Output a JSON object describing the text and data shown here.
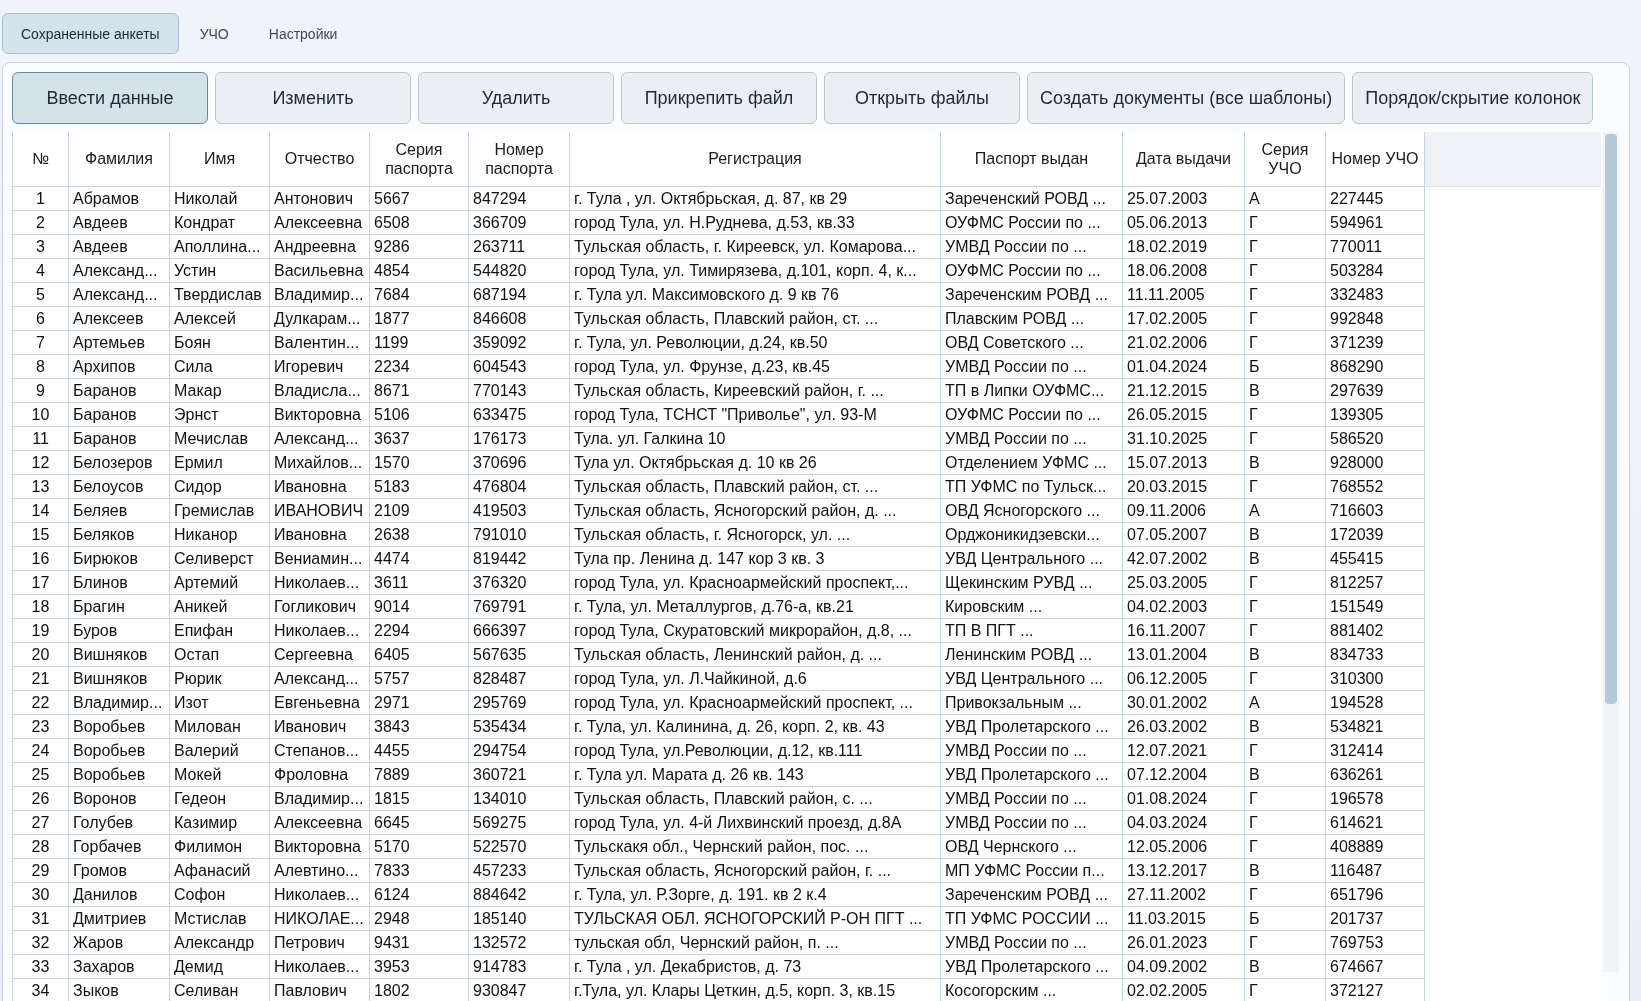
{
  "tabs": [
    {
      "label": "Сохраненные анкеты",
      "selected": true
    },
    {
      "label": "УЧО",
      "selected": false
    },
    {
      "label": "Настройки",
      "selected": false
    }
  ],
  "buttons": [
    {
      "label": "Ввести данные",
      "default": true
    },
    {
      "label": "Изменить",
      "default": false
    },
    {
      "label": "Удалить",
      "default": false
    },
    {
      "label": "Прикрепить файл",
      "default": false
    },
    {
      "label": "Открыть файлы",
      "default": false
    },
    {
      "label": "Создать документы (все шаблоны)",
      "default": false
    },
    {
      "label": "Порядок/скрытие колонок",
      "default": false
    }
  ],
  "table": {
    "columns": [
      "№",
      "Фамилия",
      "Имя",
      "Отчество",
      "Серия паспорта",
      "Номер паспорта",
      "Регистрация",
      "Паспорт выдан",
      "Дата выдачи",
      "Серия УЧО",
      "Номер УЧО"
    ],
    "rows": [
      [
        "1",
        "Абрамов",
        "Николай",
        "Антонович",
        "5667",
        "847294",
        "г. Тула , ул. Октябрьская, д. 87, кв 29",
        "Зареченский РОВД ...",
        "25.07.2003",
        "А",
        "227445"
      ],
      [
        "2",
        "Авдеев",
        "Кондрат",
        "Алексеевна",
        "6508",
        "366709",
        "город Тула, ул. Н.Руднева, д.53, кв.33",
        "ОУФМС России по ...",
        "05.06.2013",
        "Г",
        "594961"
      ],
      [
        "3",
        "Авдеев",
        "Аполлина...",
        "Андреевна",
        "9286",
        "263711",
        "Тульская область, г. Киреевск, ул. Комарова...",
        "УМВД России по ...",
        "18.02.2019",
        "Г",
        "770011"
      ],
      [
        "4",
        "Александ...",
        "Устин",
        "Васильевна",
        "4854",
        "544820",
        "город Тула, ул. Тимирязева, д.101, корп. 4, к...",
        "ОУФМС России по ...",
        "18.06.2008",
        "Г",
        "503284"
      ],
      [
        "5",
        "Александ...",
        "Твердислав",
        "Владимир...",
        "7684",
        "687194",
        "г. Тула ул. Максимовского д. 9 кв 76",
        "Зареченским РОВД ...",
        "11.11.2005",
        "Г",
        "332483"
      ],
      [
        "6",
        "Алексеев",
        "Алексей",
        "Дулкарам...",
        "1877",
        "846608",
        "Тульская область, Плавский район, ст. ...",
        "Плавским РОВД ...",
        "17.02.2005",
        "Г",
        "992848"
      ],
      [
        "7",
        "Артемьев",
        "Боян",
        "Валентин...",
        "1199",
        "359092",
        "г. Тула, ул. Революции, д.24, кв.50",
        "ОВД Советского ...",
        "21.02.2006",
        "Г",
        "371239"
      ],
      [
        "8",
        "Архипов",
        "Сила",
        "Игоревич",
        "2234",
        "604543",
        "город Тула, ул. Фрунзе, д.23, кв.45",
        "УМВД России по ...",
        "01.04.2024",
        "Б",
        "868290"
      ],
      [
        "9",
        "Баранов",
        "Макар",
        "Владисла...",
        "8671",
        "770143",
        "Тульская область, Киреевский район, г. ...",
        "ТП  в Липки ОУФМС...",
        "21.12.2015",
        "В",
        "297639"
      ],
      [
        "10",
        "Баранов",
        "Эрнст",
        "Викторовна",
        "5106",
        "633475",
        "город Тула, ТСНСТ \"Приволье\", ул. 93-М",
        "ОУФМС России по ...",
        "26.05.2015",
        "Г",
        "139305"
      ],
      [
        "11",
        "Баранов",
        "Мечислав",
        "Александ...",
        "3637",
        "176173",
        "Тула. ул. Галкина 10",
        "УМВД России по ...",
        "31.10.2025",
        "Г",
        "586520"
      ],
      [
        "12",
        "Белозеров",
        "Ермил",
        "Михайлов...",
        "1570",
        "370696",
        "Тула ул. Октябрьская д. 10 кв 26",
        "Отделением УФМС ...",
        "15.07.2013",
        "В",
        "928000"
      ],
      [
        "13",
        "Белоусов",
        "Сидор",
        "Ивановна",
        "5183",
        "476804",
        "Тульская область, Плавский район, ст. ...",
        "ТП УФМС по Тульск...",
        "20.03.2015",
        "Г",
        "768552"
      ],
      [
        "14",
        "Беляев",
        "Гремислав",
        "ИВАНОВИЧ",
        "2109",
        "419503",
        "Тульская область, Ясногорский район, д. ...",
        "ОВД Ясногорского ...",
        "09.11.2006",
        "А",
        "716603"
      ],
      [
        "15",
        "Беляков",
        "Никанор",
        "Ивановна",
        "2638",
        "791010",
        "Тульская область, г. Ясногорск, ул. ...",
        "Орджоникидзевски...",
        "07.05.2007",
        "В",
        "172039"
      ],
      [
        "16",
        "Бирюков",
        "Селиверст",
        "Вениамин...",
        "4474",
        "819442",
        "Тула пр. Ленина д. 147 кор 3 кв. 3",
        "УВД Центрального ...",
        "42.07.2002",
        "В",
        "455415"
      ],
      [
        "17",
        "Блинов",
        "Артемий",
        "Николаев...",
        "3611",
        "376320",
        "город  Тула, ул. Красноармейский проспект,...",
        "Щекинским РУВД ...",
        "25.03.2005",
        "Г",
        "812257"
      ],
      [
        "18",
        "Брагин",
        "Аникей",
        "Гогликович",
        "9014",
        "769791",
        "г. Тула, ул. Металлургов, д.76-а, кв.21",
        "Кировским ...",
        "04.02.2003",
        "Г",
        "151549"
      ],
      [
        "19",
        "Буров",
        "Епифан",
        "Николаев...",
        "2294",
        "666397",
        "город Тула, Скуратовский микрорайон, д.8, ...",
        "ТП В ПГТ ...",
        "16.11.2007",
        "Г",
        "881402"
      ],
      [
        "20",
        "Вишняков",
        "Остап",
        "Сергеевна",
        "6405",
        "567635",
        "Тульская область, Ленинский район, д. ...",
        "Ленинским РОВД ...",
        "13.01.2004",
        "В",
        "834733"
      ],
      [
        "21",
        "Вишняков",
        "Рюрик",
        "Александ...",
        "5757",
        "828487",
        "город Тула, ул. Л.Чайкиной, д.6",
        "УВД Центрального ...",
        "06.12.2005",
        "Г",
        "310300"
      ],
      [
        "22",
        "Владимир...",
        "Изот",
        "Евгеньевна",
        "2971",
        "295769",
        "город Тула, ул. Красноармейский проспект, ...",
        "Привокзальным ...",
        "30.01.2002",
        "А",
        "194528"
      ],
      [
        "23",
        "Воробьев",
        "Милован",
        "Иванович",
        "3843",
        "535434",
        "г. Тула, ул. Калинина, д. 26, корп. 2, кв. 43",
        "УВД Пролетарского ...",
        "26.03.2002",
        "В",
        "534821"
      ],
      [
        "24",
        "Воробьев",
        "Валерий",
        "Степанов...",
        "4455",
        "294754",
        "город Тула, ул.Революции, д.12, кв.111",
        "УМВД России по ...",
        "12.07.2021",
        "Г",
        "312414"
      ],
      [
        "25",
        "Воробьев",
        "Мокей",
        "Фроловна",
        "7889",
        "360721",
        "г. Тула ул. Марата д. 26 кв. 143",
        "УВД Пролетарского ...",
        "07.12.2004",
        "В",
        "636261"
      ],
      [
        "26",
        "Воронов",
        "Гедеон",
        "Владимир...",
        "1815",
        "134010",
        "Тульская область, Плавский район, с. ...",
        "УМВД России по ...",
        "01.08.2024",
        "Г",
        "196578"
      ],
      [
        "27",
        "Голубев",
        "Казимир",
        "Алексеевна",
        "6645",
        "569275",
        "город Тула, ул. 4-й Лихвинский проезд, д.8А",
        "УМВД России по ...",
        "04.03.2024",
        "Г",
        "614621"
      ],
      [
        "28",
        "Горбачев",
        "Филимон",
        "Викторовна",
        "5170",
        "522570",
        "Тульскакя обл., Чернский район, пос. ...",
        "ОВД Чернского ...",
        "12.05.2006",
        "Г",
        "408889"
      ],
      [
        "29",
        "Громов",
        "Афанасий",
        "Алевтино...",
        "7833",
        "457233",
        "Тульская область, Ясногорский район, г. ...",
        "МП УФМС России п...",
        "13.12.2017",
        "В",
        "116487"
      ],
      [
        "30",
        "Данилов",
        "Софон",
        "Николаев...",
        "6124",
        "884642",
        "г. Тула, ул. Р.Зорге, д. 191. кв 2 к.4",
        "Зареченским РОВД ...",
        "27.11.2002",
        "Г",
        "651796"
      ],
      [
        "31",
        "Дмитриев",
        "Мстислав",
        "НИКОЛАЕ...",
        "2948",
        "185140",
        "ТУЛЬСКАЯ ОБЛ. ЯСНОГОРСКИЙ Р-ОН ПГТ ...",
        "ТП УФМС РОССИИ ...",
        "11.03.2015",
        "Б",
        "201737"
      ],
      [
        "32",
        "Жаров",
        "Александр",
        "Петрович",
        "9431",
        "132572",
        "тульская обл,  Чернский район, п. ...",
        "УМВД России по ...",
        "26.01.2023",
        "Г",
        "769753"
      ],
      [
        "33",
        "Захаров",
        "Демид",
        "Николаев...",
        "3953",
        "914783",
        "г. Тула , ул. Декабристов, д. 73",
        "УВД Пролетарского ...",
        "04.09.2002",
        "В",
        "674667"
      ],
      [
        "34",
        "Зыков",
        "Селиван",
        "Павлович",
        "1802",
        "930847",
        "г.Тула, ул. Клары Цеткин, д.5, корп. 3, кв.15",
        "Косогорским ...",
        "02.02.2005",
        "Г",
        "372127"
      ]
    ]
  }
}
